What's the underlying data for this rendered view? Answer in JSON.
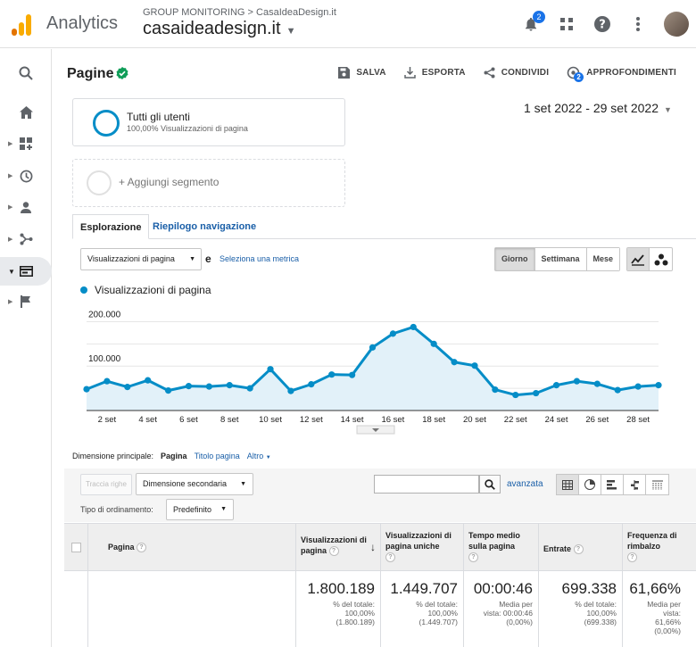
{
  "app": {
    "title": "Analytics",
    "breadcrumb": "GROUP MONITORING > CasaIdeaDesign.it",
    "property": "casaideadesign.it",
    "notifications": "2"
  },
  "colors": {
    "accent": "#058dc7",
    "link": "#1a5fa8",
    "logo_orange": "#f9ab00",
    "logo_dark": "#e37400"
  },
  "report": {
    "title": "Pagine",
    "actions": [
      {
        "label": "SALVA",
        "icon": "save-icon"
      },
      {
        "label": "ESPORTA",
        "icon": "export-icon"
      },
      {
        "label": "CONDIVIDI",
        "icon": "share-icon"
      },
      {
        "label": "APPROFONDIMENTI",
        "icon": "insights-icon",
        "badge": "2"
      }
    ]
  },
  "segments": {
    "active_name": "Tutti gli utenti",
    "active_sub": "100,00% Visualizzazioni di pagina",
    "add_label": "+ Aggiungi segmento"
  },
  "daterange": "1 set 2022 - 29 set 2022",
  "tabs": {
    "explore": "Esplorazione",
    "nav_summary": "Riepilogo navigazione"
  },
  "metric": {
    "selected": "Visualizzazioni di pagina",
    "conjunction": "e",
    "select_link": "Seleziona una metrica"
  },
  "period": {
    "day": "Giorno",
    "week": "Settimana",
    "month": "Mese"
  },
  "chart_data": {
    "type": "area",
    "series": [
      {
        "name": "Visualizzazioni di pagina",
        "values": [
          48000,
          66000,
          53000,
          68000,
          45000,
          55000,
          54000,
          57000,
          50000,
          93000,
          44000,
          59000,
          81000,
          80000,
          142000,
          173000,
          188000,
          150000,
          109000,
          101000,
          47000,
          35000,
          39000,
          57000,
          66000,
          60000,
          46000,
          54000,
          57000
        ]
      }
    ],
    "x": [
      "1 set",
      "2 set",
      "3 set",
      "4 set",
      "5 set",
      "6 set",
      "7 set",
      "8 set",
      "9 set",
      "10 set",
      "11 set",
      "12 set",
      "13 set",
      "14 set",
      "15 set",
      "16 set",
      "17 set",
      "18 set",
      "19 set",
      "20 set",
      "21 set",
      "22 set",
      "23 set",
      "24 set",
      "25 set",
      "26 set",
      "27 set",
      "28 set",
      "29 set"
    ],
    "xticks": [
      "2 set",
      "4 set",
      "6 set",
      "8 set",
      "10 set",
      "12 set",
      "14 set",
      "16 set",
      "18 set",
      "20 set",
      "22 set",
      "24 set",
      "26 set",
      "28 set"
    ],
    "yticks": [
      "200.000",
      "100.000"
    ],
    "ylim": [
      0,
      225000
    ],
    "grid": true
  },
  "dimension": {
    "label": "Dimensione principale:",
    "current": "Pagina",
    "alt": "Titolo pagina",
    "more": "Altro"
  },
  "table_controls": {
    "plot_rows": "Traccia righe",
    "secondary": "Dimensione secondaria",
    "sort_label": "Tipo di ordinamento:",
    "sort_value": "Predefinito",
    "advanced": "avanzata"
  },
  "table": {
    "headers": [
      "Pagina",
      "Visualizzazioni di pagina",
      "Visualizzazioni di pagina uniche",
      "Tempo medio sulla pagina",
      "Entrate",
      "Frequenza di rimbalzo"
    ],
    "totals": [
      {
        "value": "1.800.189",
        "l1": "% del totale:",
        "l2": "100,00%",
        "l3": "(1.800.189)"
      },
      {
        "value": "1.449.707",
        "l1": "% del totale:",
        "l2": "100,00%",
        "l3": "(1.449.707)"
      },
      {
        "value": "00:00:46",
        "l1": "Media per",
        "l2": "vista: 00:00:46",
        "l3": "(0,00%)"
      },
      {
        "value": "699.338",
        "l1": "% del totale:",
        "l2": "100,00%",
        "l3": "(699.338)"
      },
      {
        "value": "61,66%",
        "l1": "Media per",
        "l2": "vista:",
        "l3": "61,66%",
        "l4": "(0,00%)"
      }
    ]
  }
}
